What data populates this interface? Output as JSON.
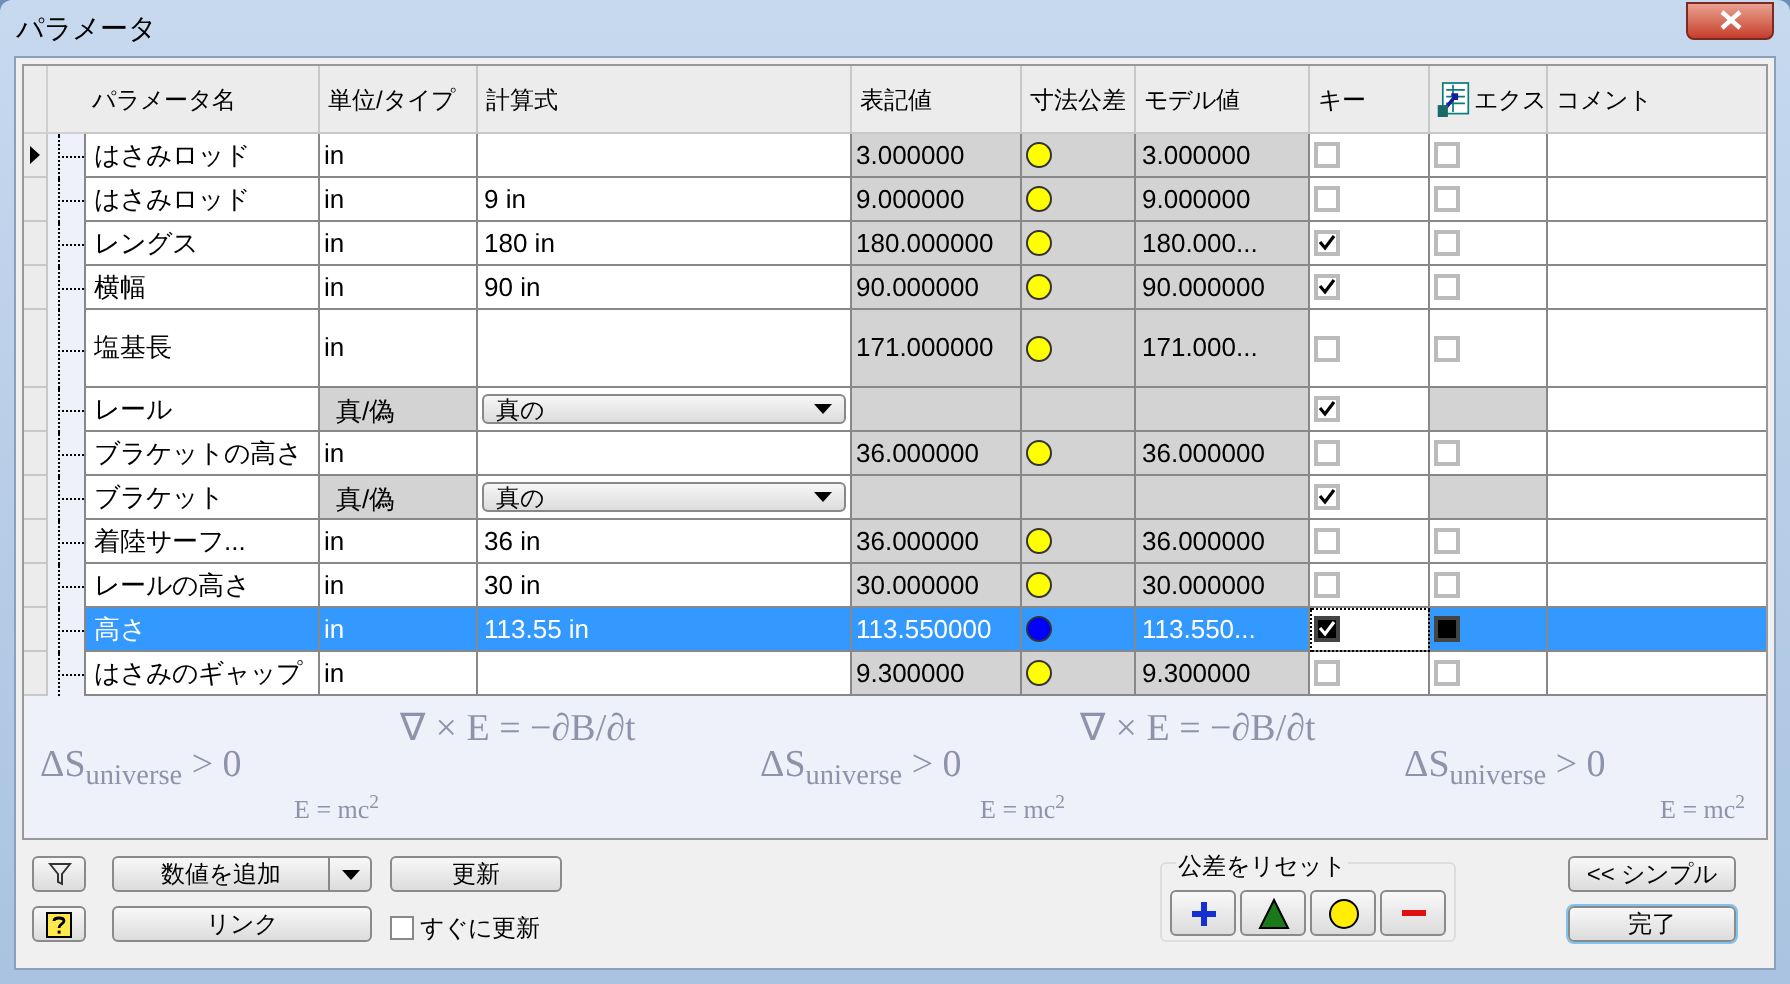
{
  "window": {
    "title": "パラメータ"
  },
  "table": {
    "columns": [
      "パラメータ名",
      "単位/タイプ",
      "計算式",
      "表記値",
      "寸法公差",
      "モデル値",
      "キー",
      "エクス",
      "コメント"
    ],
    "rows": [
      {
        "kind": "value",
        "current": true,
        "selected": false,
        "name": "はさみロッド",
        "unit": "in",
        "formula": "",
        "display": "3.000000",
        "color": "#ffff00",
        "model": "3.000000",
        "key": false,
        "export": false,
        "tall": false
      },
      {
        "kind": "value",
        "current": false,
        "selected": false,
        "name": "はさみロッド",
        "unit": "in",
        "formula": "9 in",
        "display": "9.000000",
        "color": "#ffff00",
        "model": "9.000000",
        "key": false,
        "export": false,
        "tall": false
      },
      {
        "kind": "value",
        "current": false,
        "selected": false,
        "name": "レングス",
        "unit": "in",
        "formula": "180 in",
        "display": "180.000000",
        "color": "#ffff00",
        "model": "180.000...",
        "key": true,
        "export": false,
        "tall": false
      },
      {
        "kind": "value",
        "current": false,
        "selected": false,
        "name": "横幅",
        "unit": "in",
        "formula": "90 in",
        "display": "90.000000",
        "color": "#ffff00",
        "model": "90.000000",
        "key": true,
        "export": false,
        "tall": false
      },
      {
        "kind": "value",
        "current": false,
        "selected": false,
        "name": "塩基長",
        "unit": "in",
        "formula": "",
        "display": "171.000000",
        "color": "#ffff00",
        "model": "171.000...",
        "key": false,
        "export": false,
        "tall": true
      },
      {
        "kind": "boolean",
        "current": false,
        "selected": false,
        "name": "レール",
        "unit": "真/偽",
        "formula": "真の",
        "key": true,
        "tall": false
      },
      {
        "kind": "value",
        "current": false,
        "selected": false,
        "name": "ブラケットの高さ",
        "unit": "in",
        "formula": "",
        "display": "36.000000",
        "color": "#ffff00",
        "model": "36.000000",
        "key": false,
        "export": false,
        "tall": false
      },
      {
        "kind": "boolean",
        "current": false,
        "selected": false,
        "name": "ブラケット",
        "unit": "真/偽",
        "formula": "真の",
        "key": true,
        "tall": false
      },
      {
        "kind": "value",
        "current": false,
        "selected": false,
        "name": "着陸サーフ...",
        "unit": "in",
        "formula": "36 in",
        "display": "36.000000",
        "color": "#ffff00",
        "model": "36.000000",
        "key": false,
        "export": false,
        "tall": false
      },
      {
        "kind": "value",
        "current": false,
        "selected": false,
        "name": "レールの高さ",
        "unit": "in",
        "formula": "30 in",
        "display": "30.000000",
        "color": "#ffff00",
        "model": "30.000000",
        "key": false,
        "export": false,
        "tall": false
      },
      {
        "kind": "value",
        "current": false,
        "selected": true,
        "name": "高さ",
        "unit": "in",
        "formula": "113.55 in",
        "display": "113.550000",
        "color": "#0000ff",
        "model": "113.550...",
        "key": true,
        "export": false,
        "tall": false
      },
      {
        "kind": "value",
        "current": false,
        "selected": false,
        "name": "はさみのギャップ",
        "unit": "in",
        "formula": "",
        "display": "9.300000",
        "color": "#ffff00",
        "model": "9.300000",
        "key": false,
        "export": false,
        "tall": false
      }
    ]
  },
  "background_formulas": [
    "ΔS$_{universe}$ > 0",
    "∇ × E = −∂B/∂t",
    "ΔS$_{universe}$ > 0",
    "∇ × E = −∂B/∂t",
    "ΔS$_{universe}$ > 0",
    "E = mc$^{2}$",
    "E = mc$^{2}$",
    "E = mc$^{2}$"
  ],
  "footer": {
    "add_value": "数値を追加",
    "update": "更新",
    "link": "リンク",
    "immediate_update": {
      "label": "すぐに更新",
      "checked": false
    },
    "reset_tolerance": "公差をリセット",
    "simple": "<< シンプル",
    "done": "完了"
  }
}
